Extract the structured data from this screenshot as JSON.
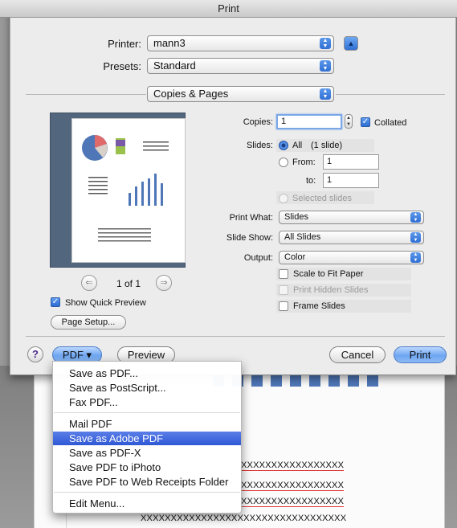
{
  "window": {
    "title": "Print"
  },
  "printer": {
    "label": "Printer:",
    "value": "mann3"
  },
  "presets": {
    "label": "Presets:",
    "value": "Standard"
  },
  "section": {
    "value": "Copies & Pages"
  },
  "preview": {
    "page_indicator": "1 of 1",
    "show_quick_preview_label": "Show Quick Preview",
    "show_quick_preview_checked": true
  },
  "page_setup_button": "Page Setup...",
  "copies": {
    "label": "Copies:",
    "value": "1",
    "collated_label": "Collated",
    "collated_checked": true
  },
  "slides": {
    "label": "Slides:",
    "all_label": "All",
    "all_detail": "(1 slide)",
    "from_label": "From:",
    "from_value": "1",
    "to_label": "to:",
    "to_value": "1",
    "selected_label": "Selected slides"
  },
  "print_what": {
    "label": "Print What:",
    "value": "Slides"
  },
  "slide_show": {
    "label": "Slide Show:",
    "value": "All Slides"
  },
  "output": {
    "label": "Output:",
    "value": "Color"
  },
  "options": {
    "scale_to_fit": "Scale to Fit Paper",
    "print_hidden": "Print Hidden Slides",
    "frame_slides": "Frame Slides"
  },
  "bottom": {
    "help": "?",
    "pdf_button": "PDF ▾",
    "preview_button": "Preview",
    "cancel_button": "Cancel",
    "print_button": "Print"
  },
  "pdf_menu": {
    "items": [
      "Save as PDF...",
      "Save as PostScript...",
      "Fax PDF...",
      "Mail PDF",
      "Save as Adobe PDF",
      "Save as PDF-X",
      "Save PDF to iPhoto",
      "Save PDF to Web Receipts Folder",
      "Edit Menu..."
    ],
    "highlighted": "Save as Adobe PDF"
  },
  "background_doc": {
    "rows": [
      "XXXXXXXXXXXXXXXXX",
      "XXXXXXXXXXXXXXXXX",
      "XXXXXXXXXXXXXXXXX",
      "XXXXXXXXXXXXXXXXXXXXXXXXXXXXXXXXXX"
    ]
  },
  "colors": {
    "accent": "#2f6fd4",
    "highlight": "#3a62d9",
    "preview_bg": "#52667d"
  }
}
